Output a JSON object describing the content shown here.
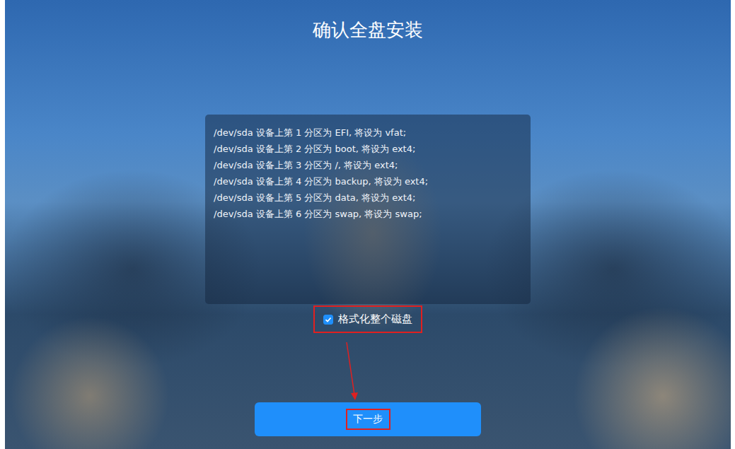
{
  "title": "确认全盘安装",
  "partitions": [
    "/dev/sda 设备上第 1 分区为 EFI, 将设为 vfat;",
    "/dev/sda 设备上第 2 分区为 boot, 将设为 ext4;",
    "/dev/sda 设备上第 3 分区为 /, 将设为 ext4;",
    "/dev/sda 设备上第 4 分区为 backup, 将设为 ext4;",
    "/dev/sda 设备上第 5 分区为 data, 将设为 ext4;",
    "/dev/sda 设备上第 6 分区为 swap, 将设为 swap;"
  ],
  "format_disk": {
    "label": "格式化整个磁盘",
    "checked": true
  },
  "next_button": {
    "label": "下一步"
  }
}
